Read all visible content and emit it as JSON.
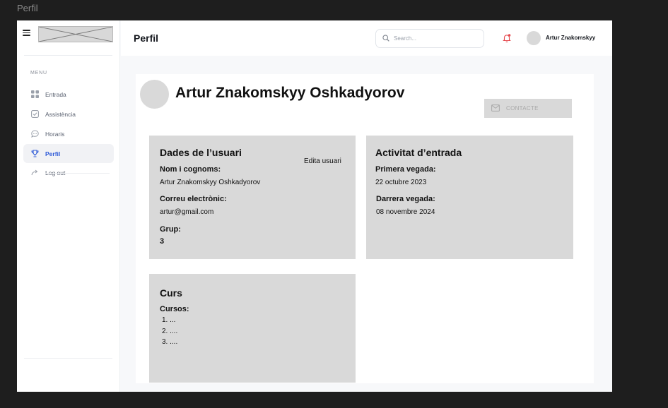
{
  "frame_title": "Perfil",
  "sidebar": {
    "menu_label": "MENU",
    "items": [
      {
        "label": "Entrada",
        "icon": "grid-icon",
        "active": false
      },
      {
        "label": "Assistència",
        "icon": "check-square-icon",
        "active": false
      },
      {
        "label": "Horaris",
        "icon": "chat-bubble-icon",
        "active": false
      },
      {
        "label": "Perfil",
        "icon": "trophy-icon",
        "active": true
      },
      {
        "label": "Log out",
        "icon": "logout-arrow-icon",
        "active": false
      }
    ]
  },
  "header": {
    "title": "Perfil",
    "search_placeholder": "Search...",
    "user_name": "Artur Znakomskyy"
  },
  "profile": {
    "full_name": "Artur Znakomskyy Oshkadyorov",
    "contact_label": "CONTACTE"
  },
  "user_card": {
    "title": "Dades de l’usuari",
    "edit_label": "Edita usuari",
    "name_label": "Nom i cognoms:",
    "name_value": "Artur Znakomskyy Oshkadyorov",
    "email_label": "Correu electrònic:",
    "email_value": "artur@gmail.com",
    "group_label": "Grup:",
    "group_value": "3"
  },
  "activity_card": {
    "title": "Activitat d’entrada",
    "first_label": "Primera vegada:",
    "first_value": "22 octubre 2023",
    "last_label": "Darrera vegada:",
    "last_value": "08 novembre 2024"
  },
  "course_card": {
    "title": "Curs",
    "courses_label": "Cursos:",
    "courses": [
      "1. ...",
      "2. ....",
      "3. ...."
    ]
  },
  "colors": {
    "accent": "#2f5bd8",
    "notification": "#e5484d",
    "card_gray": "#d9d9d9"
  }
}
